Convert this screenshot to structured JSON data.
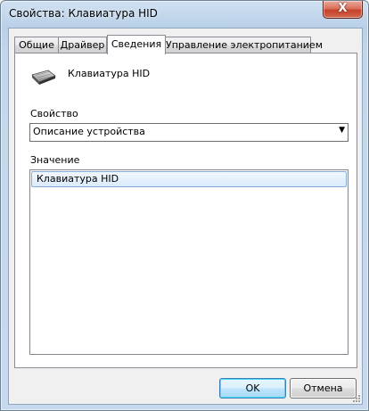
{
  "window": {
    "title": "Свойства: Клавиатура HID",
    "close_glyph": "X"
  },
  "tabs": [
    {
      "label": "Общие",
      "active": false
    },
    {
      "label": "Драйвер",
      "active": false
    },
    {
      "label": "Сведения",
      "active": true
    },
    {
      "label": "Управление электропитанием",
      "active": false
    }
  ],
  "device": {
    "name": "Клавиатура HID",
    "icon": "keyboard-icon"
  },
  "property": {
    "label": "Свойство",
    "selected": "Описание устройства"
  },
  "value": {
    "label": "Значение",
    "items": [
      "Клавиатура HID"
    ]
  },
  "buttons": {
    "ok": "OK",
    "cancel": "Отмена"
  },
  "colors": {
    "selection": "#dbeafc",
    "selection_border": "#84acdd",
    "close": "#c5412a"
  }
}
